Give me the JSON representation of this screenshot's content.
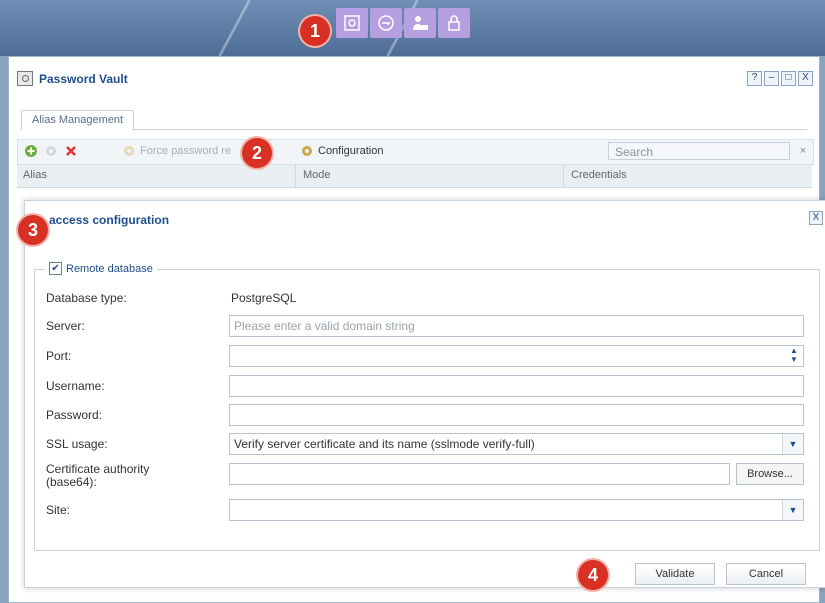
{
  "vault_window": {
    "title": "Password Vault",
    "controls": [
      "?",
      "–",
      "□",
      "X"
    ]
  },
  "tabs": [
    {
      "label": "Alias Management"
    }
  ],
  "toolbar": {
    "force_label": "Force password re",
    "config_label": "Configuration",
    "search_placeholder": "Search",
    "search_clear": "×"
  },
  "table": {
    "columns": [
      "Alias",
      "Mode",
      "Credentials"
    ]
  },
  "dialog": {
    "title": "e access configuration",
    "close": "X",
    "remote_db_label": "Remote database",
    "remote_db_checked": true,
    "fields": {
      "db_type_label": "Database type:",
      "db_type_value": "PostgreSQL",
      "server_label": "Server:",
      "server_placeholder": "Please enter a valid domain string",
      "port_label": "Port:",
      "username_label": "Username:",
      "password_label": "Password:",
      "ssl_label": "SSL usage:",
      "ssl_value": "Verify server certificate and its name (sslmode verify-full)",
      "ca_label_1": "Certificate authority",
      "ca_label_2": "(base64):",
      "browse_label": "Browse...",
      "site_label": "Site:"
    },
    "validate_label": "Validate",
    "cancel_label": "Cancel"
  },
  "badges": [
    "1",
    "2",
    "3",
    "4"
  ],
  "colors": {
    "accent": "#1f4e8c",
    "badge": "#d93025",
    "toolbar_icon_bg": "#b59fe0"
  }
}
